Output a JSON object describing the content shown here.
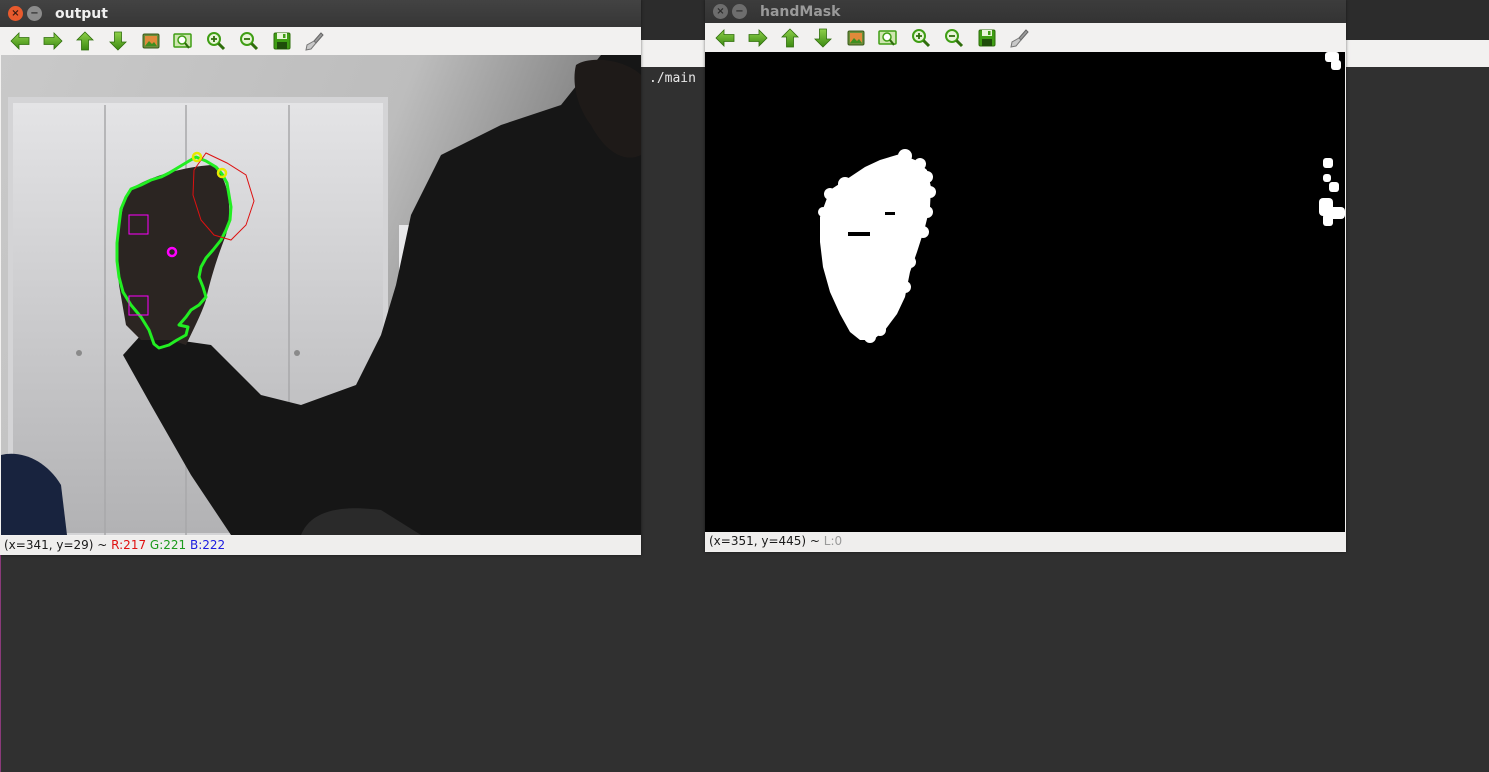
{
  "terminal": {
    "text": "./main"
  },
  "windows": {
    "output": {
      "title": "output",
      "status": {
        "coords": "(x=341, y=29) ~ ",
        "r": "R:217",
        "g": "G:221",
        "b": "B:222"
      }
    },
    "handmask": {
      "title": "handMask",
      "status": {
        "coords": "(x=351, y=445) ~ ",
        "l": "L:0"
      }
    }
  },
  "window_buttons": {
    "close": "×",
    "minimize": "−"
  },
  "toolbar": [
    {
      "name": "pan-left",
      "icon": "arrow-left-icon"
    },
    {
      "name": "pan-right",
      "icon": "arrow-right-icon"
    },
    {
      "name": "pan-up",
      "icon": "arrow-up-icon"
    },
    {
      "name": "pan-down",
      "icon": "arrow-down-icon"
    },
    {
      "name": "zoom-x1",
      "icon": "image-icon"
    },
    {
      "name": "zoom-fit",
      "icon": "zoom-fit-icon"
    },
    {
      "name": "zoom-in",
      "icon": "zoom-in-icon"
    },
    {
      "name": "zoom-out",
      "icon": "zoom-out-icon"
    },
    {
      "name": "save",
      "icon": "save-icon"
    },
    {
      "name": "properties",
      "icon": "brush-icon"
    }
  ],
  "colors": {
    "contour": "#22ee22",
    "fingertip": "#e8e800",
    "palm_center": "#ff00ff",
    "convex_region": "#dd1111",
    "icon_green": "#3f9e14"
  }
}
